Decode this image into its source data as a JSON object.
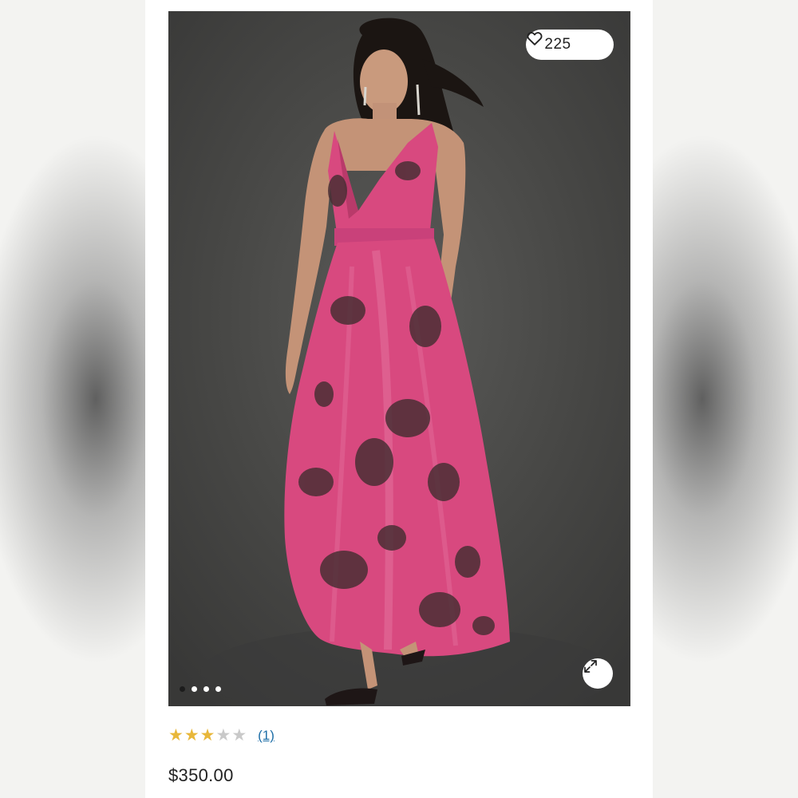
{
  "product": {
    "likes_count": "225",
    "rating": 3,
    "rating_max": 5,
    "review_count": "(1)",
    "price": "$350.00",
    "image_alt": "Model wearing pink sequin floral wrap maxi dress"
  },
  "gallery": {
    "total_images": 4,
    "active_index": 0
  },
  "icons": {
    "like": "heart-icon",
    "expand": "expand-icon",
    "star": "star-icon"
  },
  "colors": {
    "star_filled": "#e8b73a",
    "star_empty": "#c9c9c9",
    "link": "#1f6fa8",
    "photo_background": "#474745",
    "dress_pink": "#d8497f"
  }
}
